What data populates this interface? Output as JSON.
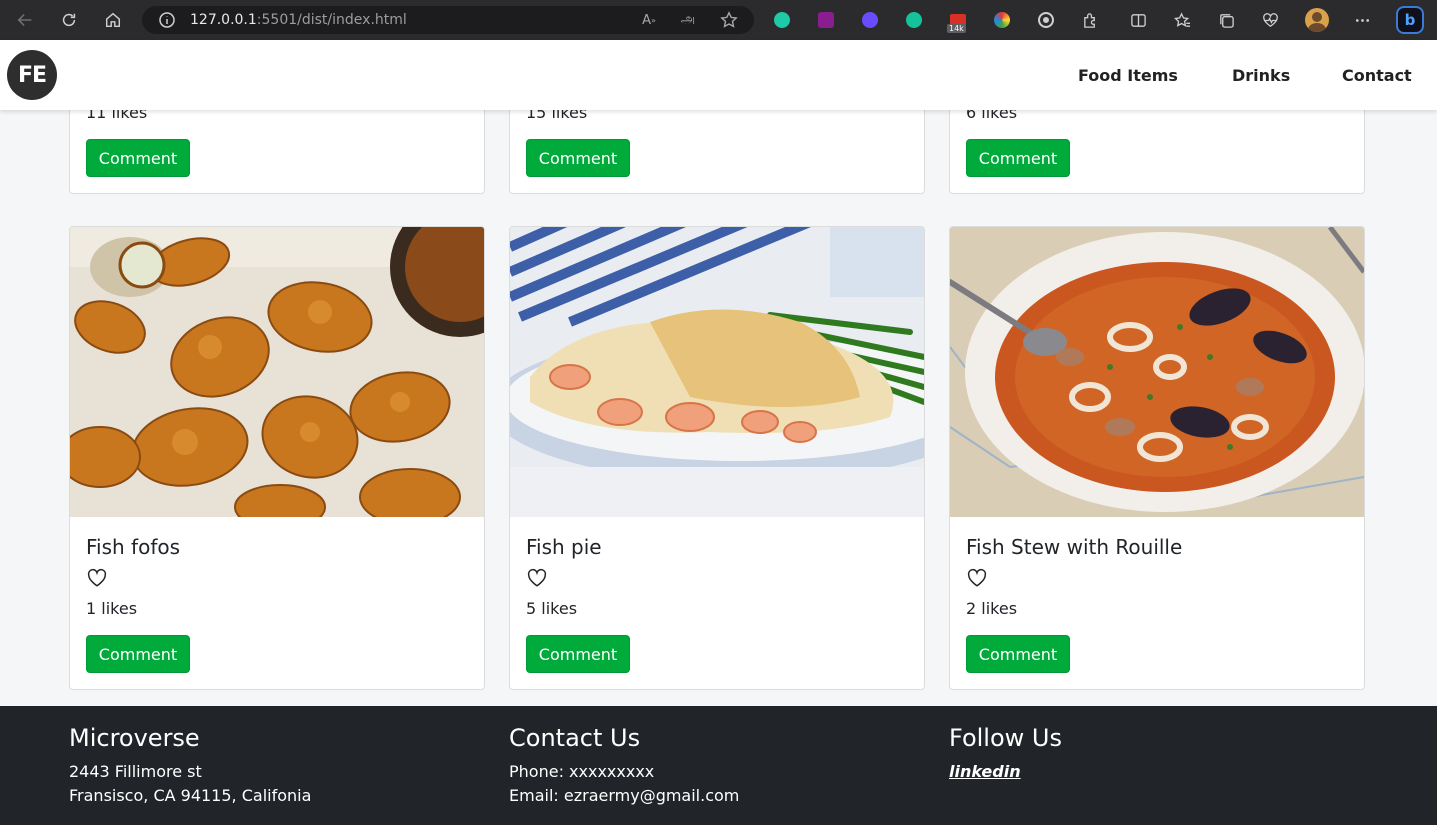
{
  "browser": {
    "url_host": "127.0.0.1",
    "url_rest": ":5501/dist/index.html",
    "extension_badge": "14k"
  },
  "header": {
    "logo": "FE",
    "nav": [
      "Food Items",
      "Drinks",
      "Contact"
    ]
  },
  "top_row_cards": [
    {
      "likes": "11 likes",
      "button": "Comment"
    },
    {
      "likes": "15 likes",
      "button": "Comment"
    },
    {
      "likes": "6 likes",
      "button": "Comment"
    }
  ],
  "cards": [
    {
      "title": "Fish fofos",
      "likes": "1 likes",
      "button": "Comment",
      "icon": "heart-outline-icon"
    },
    {
      "title": "Fish pie",
      "likes": "5 likes",
      "button": "Comment",
      "icon": "heart-outline-icon"
    },
    {
      "title": "Fish Stew with Rouille",
      "likes": "2 likes",
      "button": "Comment",
      "icon": "heart-outline-icon"
    }
  ],
  "footer": {
    "col1": {
      "heading": "Microverse",
      "line1": "2443 Fillimore st",
      "line2": "Fransisco, CA 94115, Califonia"
    },
    "col2": {
      "heading": "Contact Us",
      "line1": "Phone: xxxxxxxxx",
      "line2": "Email: ezraermy@gmail.com"
    },
    "col3": {
      "heading": "Follow Us",
      "link": "linkedin"
    }
  },
  "colors": {
    "comment_button": "#00ab3c",
    "footer_bg": "#212529",
    "page_bg": "#f5f6f8"
  }
}
